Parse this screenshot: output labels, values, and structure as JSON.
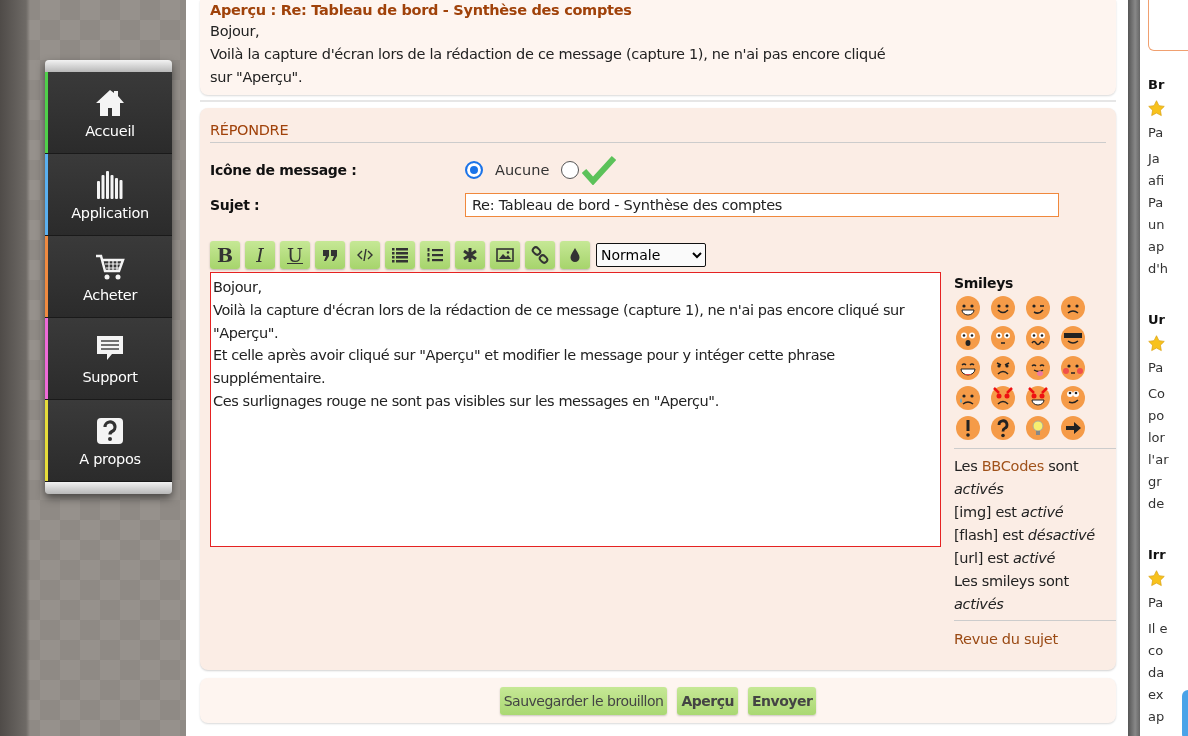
{
  "nav": [
    {
      "label": "Accueil",
      "kind": "home",
      "color": "#4fd04a"
    },
    {
      "label": "Application",
      "kind": "bars",
      "color": "#5ab0f0"
    },
    {
      "label": "Acheter",
      "kind": "cart",
      "color": "#f08a40"
    },
    {
      "label": "Support",
      "kind": "chat",
      "color": "#ee6ad8"
    },
    {
      "label": "A propos",
      "kind": "help",
      "color": "#e6dc3a"
    }
  ],
  "preview": {
    "title": "Aperçu : Re: Tableau de bord - Synthèse des comptes",
    "lines": [
      "Bojour,",
      "Voilà la capture d'écran lors de la rédaction de ce message (capture 1), ne n'ai pas encore cliqué sur \"Aperçu\"."
    ]
  },
  "reply": {
    "heading": "RÉPONDRE",
    "icon_label": "Icône de message :",
    "icon_options": [
      {
        "kind": "none",
        "label": "Aucune",
        "selected": true
      },
      {
        "kind": "check",
        "selected": false
      }
    ],
    "subject_label": "Sujet :",
    "subject": "Re: Tableau de bord - Synthèse des comptes",
    "toolbar": [
      {
        "kind": "bold",
        "label": "B"
      },
      {
        "kind": "italic",
        "label": "I"
      },
      {
        "kind": "underline",
        "label": "U"
      },
      {
        "kind": "quote"
      },
      {
        "kind": "code"
      },
      {
        "kind": "list"
      },
      {
        "kind": "numbered"
      },
      {
        "kind": "asterisk"
      },
      {
        "kind": "image"
      },
      {
        "kind": "link"
      },
      {
        "kind": "drop"
      }
    ],
    "font_size": "Normale",
    "message": [
      "Bojour,",
      "Voilà la capture d'écran lors de la rédaction de ce message (capture 1), ne n'ai pas encore cliqué sur \"Aperçu\".",
      "Et celle après avoir cliqué sur \"Aperçu\" et modifier le message pour y intéger cette phrase supplémentaire.",
      "Ces surlignages rouge ne sont pas visibles sur les messages en \"Aperçu\"."
    ],
    "smileys_title": "Smileys",
    "smileys": [
      {
        "kind": "grin"
      },
      {
        "kind": "smile"
      },
      {
        "kind": "wink"
      },
      {
        "kind": "sad"
      },
      {
        "kind": "shock"
      },
      {
        "kind": "eek"
      },
      {
        "kind": "confused"
      },
      {
        "kind": "cool"
      },
      {
        "kind": "laugh"
      },
      {
        "kind": "mad"
      },
      {
        "kind": "razz"
      },
      {
        "kind": "blush"
      },
      {
        "kind": "cry"
      },
      {
        "kind": "evil"
      },
      {
        "kind": "twisted"
      },
      {
        "kind": "rolleyes"
      },
      {
        "kind": "exclaim"
      },
      {
        "kind": "question"
      },
      {
        "kind": "idea"
      },
      {
        "kind": "arrow"
      }
    ],
    "bbcode": {
      "before": "Les",
      "link": "BBCodes",
      "after": "sont *activés*"
    },
    "status_lines": [
      "[img] est *activé*",
      "[flash] est *désactivé*",
      "[url] est *activé*",
      "Les smileys sont *activés*"
    ],
    "review_link": "Revue du sujet"
  },
  "buttons": [
    {
      "label": "Sauvegarder le brouillon",
      "primary": false
    },
    {
      "label": "Aperçu",
      "primary": true
    },
    {
      "label": "Envoyer",
      "primary": true
    }
  ],
  "side_topics": [
    {
      "title": "Br",
      "author": "Pa",
      "lines": [
        "Ja",
        "afi",
        "Pa",
        "un",
        "ap",
        "d'h"
      ]
    },
    {
      "title": "Ur",
      "author": "Pa",
      "lines": [
        "Co",
        "po",
        "lor",
        "l'ar",
        "gr",
        "de"
      ]
    },
    {
      "title": "Irr",
      "author": "Pa",
      "lines": [
        "Il e",
        "co",
        "da",
        "ex",
        "ap"
      ]
    }
  ]
}
